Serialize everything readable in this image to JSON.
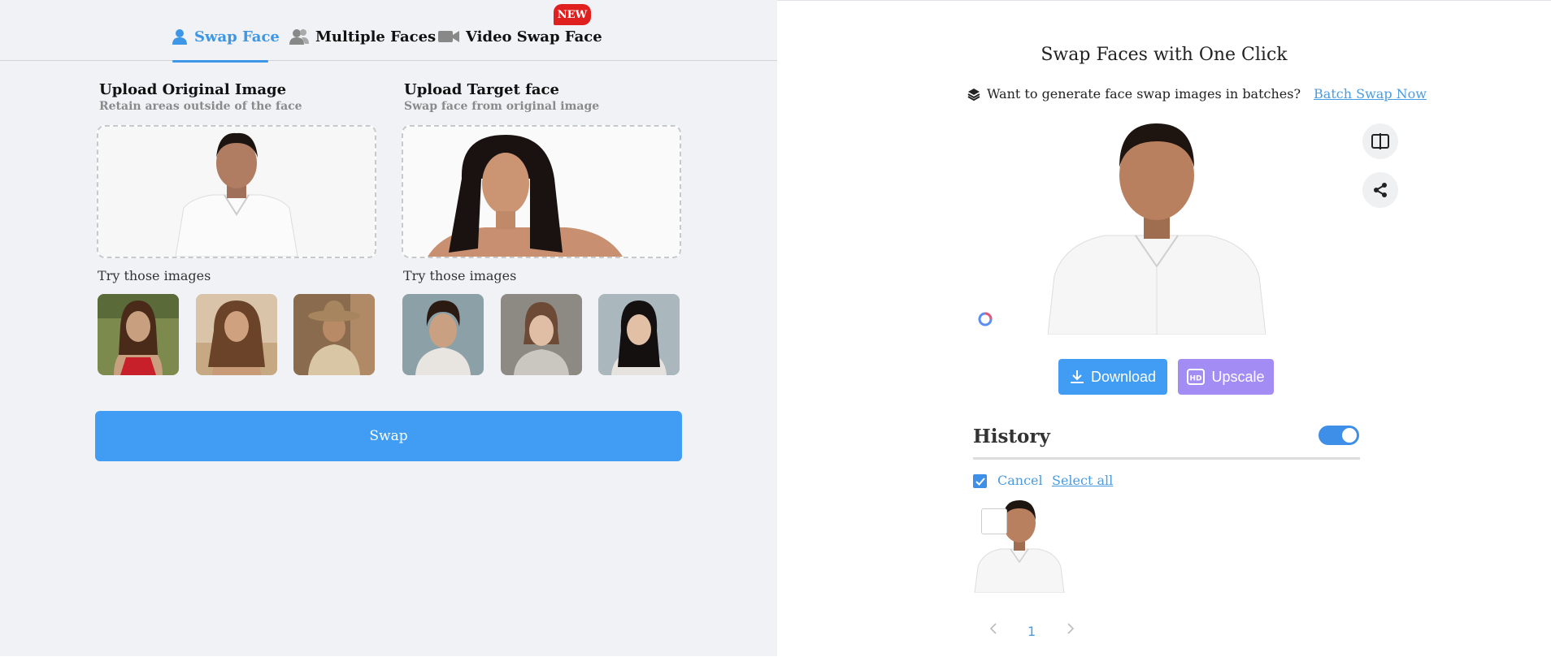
{
  "tabs": {
    "swap_face": "Swap Face",
    "multiple_faces": "Multiple Faces",
    "video_swap_face": "Video Swap Face",
    "new_badge": "NEW"
  },
  "original": {
    "title": "Upload Original Image",
    "subtitle": "Retain areas outside of the face",
    "try_label": "Try those images"
  },
  "target": {
    "title": "Upload Target face",
    "subtitle": "Swap face from original image",
    "try_label": "Try those images"
  },
  "swap_button": "Swap",
  "result": {
    "title": "Swap Faces with One Click",
    "batch_question": "Want to generate face swap images in batches?",
    "batch_link": "Batch Swap Now",
    "download": "Download",
    "upscale": "Upscale"
  },
  "history": {
    "title": "History",
    "cancel": "Cancel",
    "select_all": "Select all",
    "page": "1"
  },
  "colors": {
    "accent": "#419cf4",
    "upscale": "#a48cf5",
    "badge": "#e01f1f"
  }
}
